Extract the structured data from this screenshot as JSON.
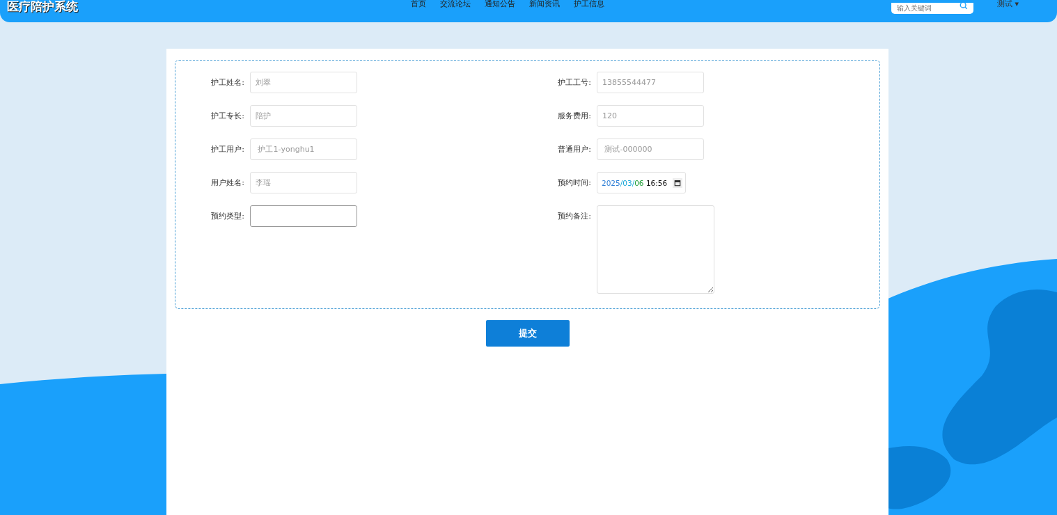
{
  "header": {
    "title": "医疗陪护系统",
    "nav": [
      {
        "label": "首页"
      },
      {
        "label": "交流论坛"
      },
      {
        "label": "通知公告"
      },
      {
        "label": "新闻资讯"
      },
      {
        "label": "护工信息"
      }
    ],
    "search": {
      "placeholder": "输入关键词"
    },
    "user": {
      "label": "测试",
      "caret": "▾"
    }
  },
  "form": {
    "fields": [
      {
        "label": "护工姓名:",
        "kind": "text",
        "value": "刘翠"
      },
      {
        "label": "护工工号:",
        "kind": "text",
        "value": "13855544477"
      },
      {
        "label": "护工专长:",
        "kind": "text",
        "value": "陪护"
      },
      {
        "label": "服务费用:",
        "kind": "text",
        "value": "120"
      },
      {
        "label": "护工用户:",
        "kind": "text",
        "value": " 护工1-yonghu1"
      },
      {
        "label": "普通用户:",
        "kind": "text",
        "value": " 测试-000000"
      },
      {
        "label": "用户姓名:",
        "kind": "text",
        "value": "李瑶"
      },
      {
        "label": "预约时间:",
        "kind": "datetime",
        "parts": [
          {
            "text": "2025",
            "color": "#2f7fd6"
          },
          {
            "text": "/03/",
            "color": "#1aa8d8"
          },
          {
            "text": "06",
            "color": "#1e9e36"
          },
          {
            "text": " 16:56",
            "color": "#111111"
          }
        ]
      },
      {
        "label": "预约类型:",
        "kind": "select"
      },
      {
        "label": "预约备注:",
        "kind": "textarea"
      }
    ],
    "submit": "提交"
  }
}
